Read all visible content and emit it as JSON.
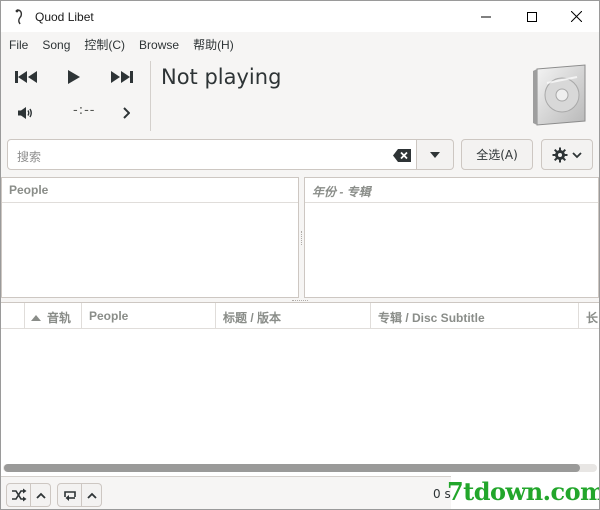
{
  "window": {
    "title": "Quod Libet"
  },
  "menu": {
    "items": [
      "File",
      "Song",
      "控制(C)",
      "Browse",
      "帮助(H)"
    ]
  },
  "player": {
    "status": "Not playing",
    "time": "-:--"
  },
  "search": {
    "placeholder": "搜索"
  },
  "buttons": {
    "select_all": "全选(A)"
  },
  "browser": {
    "left_header": "People",
    "right_header": "年份 - 专辑"
  },
  "songlist": {
    "columns": [
      "",
      "音轨",
      "People",
      "标题 / 版本",
      "专辑 / Disc Subtitle",
      "长"
    ]
  },
  "statusbar": {
    "text": "0 s"
  },
  "watermark": {
    "text": "7tdown.com"
  },
  "icons": {
    "app": "quodlibet-icon",
    "minimize": "minimize-icon",
    "maximize": "maximize-icon",
    "close": "close-icon",
    "previous": "skip-previous-icon",
    "play": "play-icon",
    "next": "skip-next-icon",
    "volume": "volume-icon",
    "seek": "chevron-right-icon",
    "album": "album-cover-icon",
    "clear": "clear-text-icon",
    "dropdown": "chevron-down-icon",
    "prefs": "gear-icon",
    "shuffle": "shuffle-icon",
    "repeat": "repeat-icon"
  },
  "colors": {
    "accent": "#2e3436",
    "watermark": "#22a62b"
  }
}
